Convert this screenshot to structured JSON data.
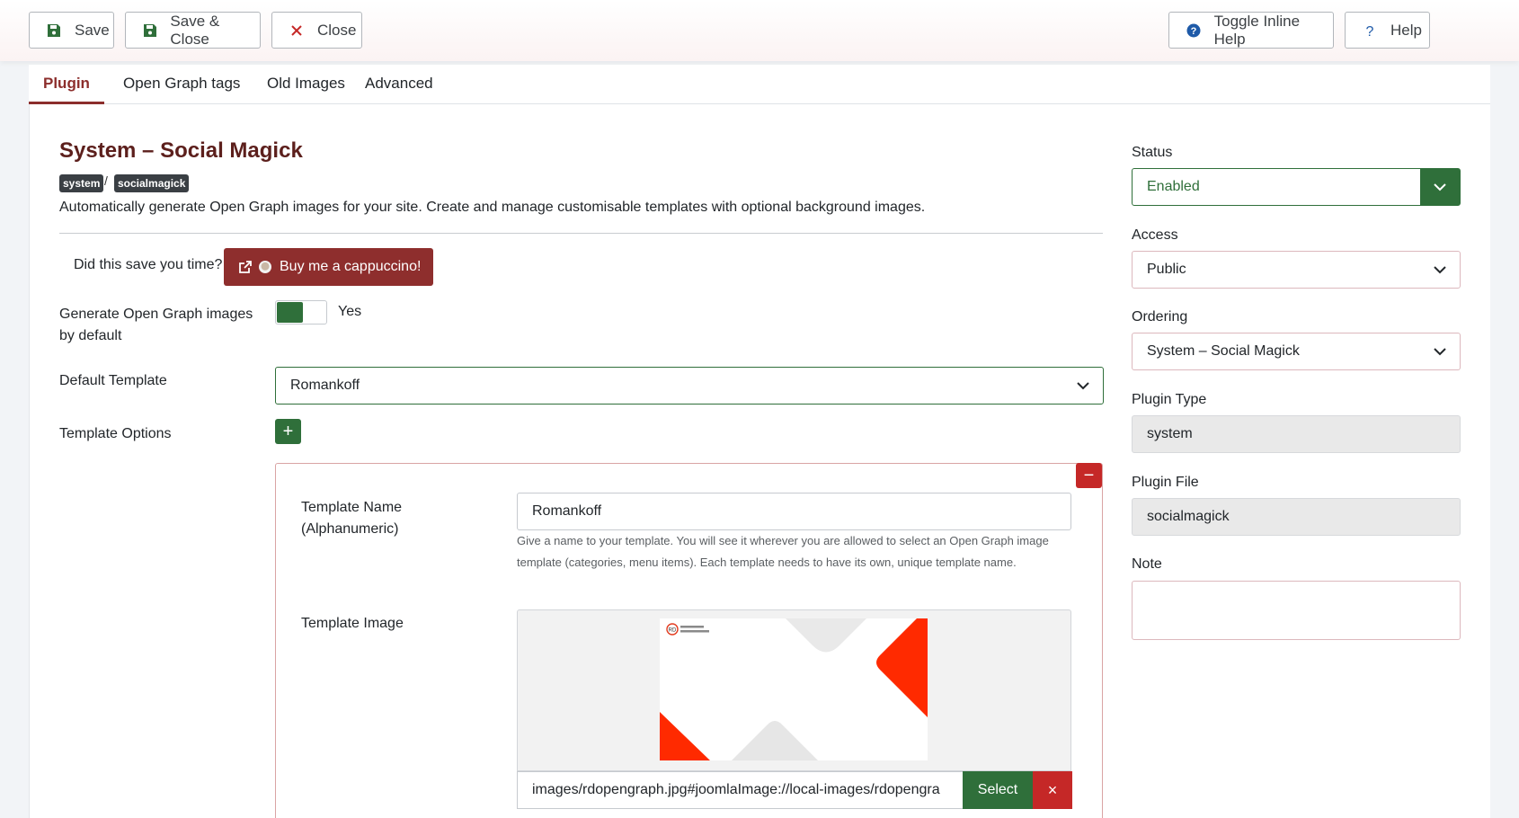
{
  "toolbar": {
    "save": "Save",
    "save_close": "Save & Close",
    "close": "Close",
    "toggle_help": "Toggle Inline Help",
    "help": "Help"
  },
  "tabs": [
    "Plugin",
    "Open Graph tags",
    "Old Images",
    "Advanced"
  ],
  "active_tab": "Plugin",
  "plugin": {
    "title": "System – Social Magick",
    "tag1": "system",
    "tag2": "socialmagick",
    "description": "Automatically generate Open Graph images for your site. Create and manage customisable templates with optional background images.",
    "saved_text": "Did this save you time?",
    "buy_label": "Buy me a cappuccino!"
  },
  "form": {
    "generate_label_1": "Generate Open Graph images",
    "generate_label_2": "by default",
    "generate_value": "Yes",
    "default_template_label": "Default Template",
    "default_template_value": "Romankoff",
    "template_options_label": "Template Options",
    "template_name_label_1": "Template Name",
    "template_name_label_2": "(Alphanumeric)",
    "template_name_value": "Romankoff",
    "template_name_help": "Give a name to your template. You will see it wherever you are allowed to select an Open Graph image template (categories, menu items). Each template needs to have its own, unique template name.",
    "template_image_label": "Template Image",
    "template_image_path": "images/rdopengraph.jpg#joomlaImage://local-images/rdopengra",
    "select_label": "Select",
    "clear_label": "×"
  },
  "sidebar": {
    "status_label": "Status",
    "status_value": "Enabled",
    "access_label": "Access",
    "access_value": "Public",
    "ordering_label": "Ordering",
    "ordering_value": "System – Social Magick",
    "type_label": "Plugin Type",
    "type_value": "system",
    "file_label": "Plugin File",
    "file_value": "socialmagick",
    "note_label": "Note",
    "note_value": ""
  },
  "colors": {
    "brand": "#8c2e2c",
    "success": "#2f6f3a",
    "danger": "#c52827"
  }
}
